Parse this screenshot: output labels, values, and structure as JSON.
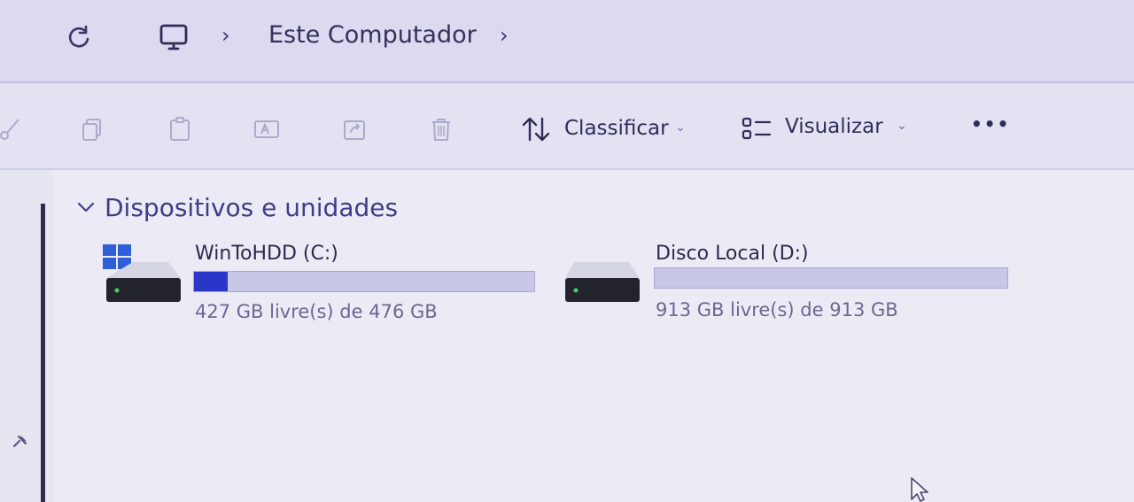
{
  "address_bar": {
    "location": "Este Computador"
  },
  "toolbar": {
    "sort_label": "Classificar",
    "view_label": "Visualizar",
    "more_label": "•••"
  },
  "section": {
    "title": "Dispositivos e unidades"
  },
  "drives": [
    {
      "name": "WinToHDD (C:)",
      "space_text": "427 GB livre(s) de 476 GB",
      "used_fraction": 0.098
    },
    {
      "name": "Disco Local (D:)",
      "space_text": "913 GB livre(s) de 913 GB",
      "used_fraction": 0.0
    }
  ],
  "colors": {
    "accent": "#2a36c8",
    "bar_track": "#c9c7e8"
  }
}
